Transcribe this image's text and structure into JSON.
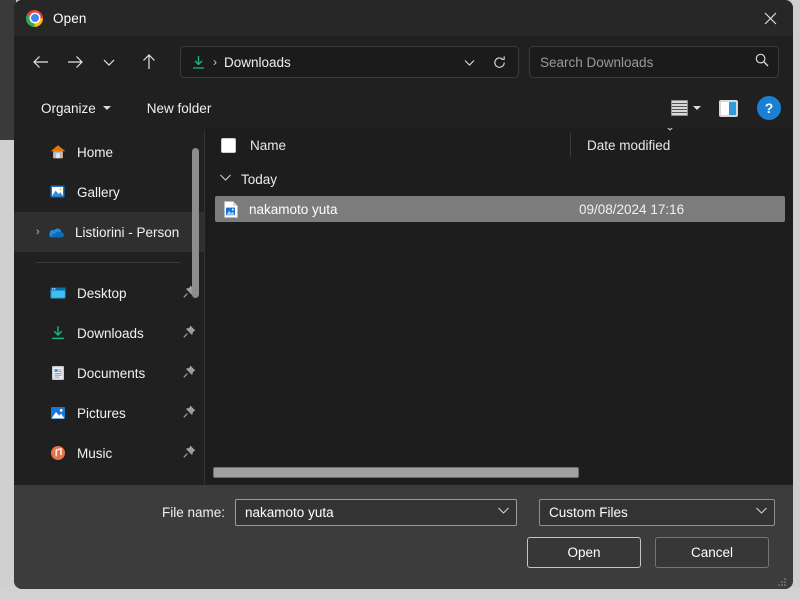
{
  "window": {
    "title": "Open",
    "app_icon": "chrome-logo-icon",
    "close_label": "✕"
  },
  "nav": {
    "back": "←",
    "forward": "→",
    "recent": "⌄",
    "up": "↑"
  },
  "address": {
    "icon": "downloads-arrow-icon",
    "separator": "›",
    "crumb": "Downloads",
    "dropdown": "⌄",
    "refresh": "⟳"
  },
  "search": {
    "placeholder": "Search Downloads",
    "icon": "search-icon"
  },
  "toolbar": {
    "organize_label": "Organize",
    "new_folder_label": "New folder",
    "view_label": "view-options",
    "preview_pane_label": "preview-pane",
    "help_label": "?"
  },
  "sidebar": {
    "items": [
      {
        "label": "Home",
        "icon": "home-icon",
        "pinned": false,
        "selected": false,
        "expandable": false
      },
      {
        "label": "Gallery",
        "icon": "gallery-icon",
        "pinned": false,
        "selected": false,
        "expandable": false
      },
      {
        "label": "Listiorini - Person",
        "icon": "onedrive-icon",
        "pinned": false,
        "selected": true,
        "expandable": true
      },
      {
        "label": "Desktop",
        "icon": "desktop-icon",
        "pinned": true,
        "selected": false,
        "expandable": false
      },
      {
        "label": "Downloads",
        "icon": "downloads-icon",
        "pinned": true,
        "selected": false,
        "expandable": false
      },
      {
        "label": "Documents",
        "icon": "documents-icon",
        "pinned": true,
        "selected": false,
        "expandable": false
      },
      {
        "label": "Pictures",
        "icon": "pictures-icon",
        "pinned": true,
        "selected": false,
        "expandable": false
      },
      {
        "label": "Music",
        "icon": "music-icon",
        "pinned": true,
        "selected": false,
        "expandable": false
      }
    ],
    "pin_glyph": "📌"
  },
  "filelist": {
    "columns": {
      "name": "Name",
      "date_modified": "Date modified"
    },
    "group": {
      "label": "Today",
      "chevron": "⌄"
    },
    "rows": [
      {
        "name": "nakamoto yuta",
        "date_modified": "09/08/2024 17:16",
        "icon": "image-file-icon",
        "selected": true
      }
    ]
  },
  "bottom": {
    "file_name_label": "File name:",
    "file_name_value": "nakamoto yuta",
    "filter_value": "Custom Files",
    "open_label": "Open",
    "cancel_label": "Cancel",
    "chevron": "⌄"
  }
}
